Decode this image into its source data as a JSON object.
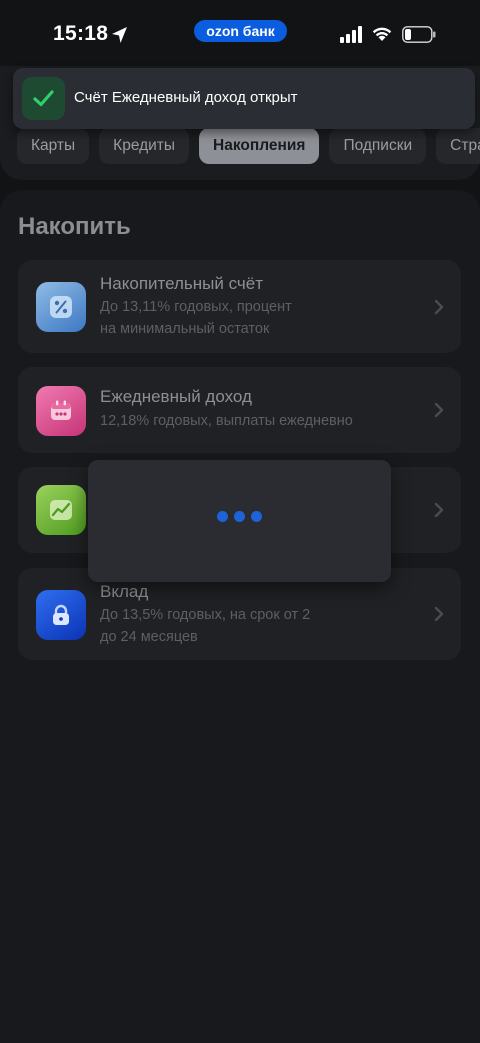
{
  "status_bar": {
    "time": "15:18",
    "app_pill": "ozon банк"
  },
  "toast": {
    "message": "Счёт Ежедневный доход открыт"
  },
  "tabs": [
    {
      "label": "Карты",
      "active": false
    },
    {
      "label": "Кредиты",
      "active": false
    },
    {
      "label": "Накопления",
      "active": true
    },
    {
      "label": "Подписки",
      "active": false
    },
    {
      "label": "Стра",
      "active": false
    }
  ],
  "section": {
    "title": "Накопить"
  },
  "items": [
    {
      "title": "Накопительный счёт",
      "desc_line1": "До 13,11% годовых, процент",
      "desc_line2": "на минимальный остаток",
      "icon": "percent-icon"
    },
    {
      "title": "Ежедневный доход",
      "desc_line1": "12,18% годовых, выплаты ежедневно",
      "desc_line2": "",
      "icon": "calendar-icon"
    },
    {
      "title": "",
      "desc_line1": "",
      "desc_line2": "",
      "icon": "chart-growth-icon"
    },
    {
      "title": "Вклад",
      "desc_line1": "До 13,5% годовых, на срок от 2",
      "desc_line2": "до 24 месяцев",
      "icon": "lock-icon"
    }
  ],
  "colors": {
    "background": "#121315",
    "card": "#202124",
    "accent_blue": "#0a5dde",
    "success_green": "#2fd06b",
    "loader_dot": "#1f63d8"
  }
}
